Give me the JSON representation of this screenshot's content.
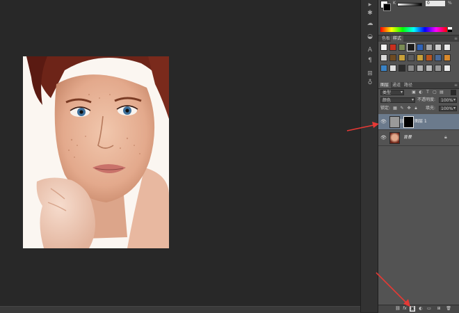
{
  "color_panel": {
    "channel_label": "K",
    "channel_value": "0",
    "channel_unit": "%"
  },
  "swatches_tabs": [
    {
      "label": "色板",
      "active": false
    },
    {
      "label": "样式",
      "active": true
    }
  ],
  "styles_grid": {
    "colors": [
      "#f4f4f4",
      "#c92f1e",
      "#7a8b55",
      "#1b1b1b",
      "#2f63b8",
      "#a8a8a8",
      "#cfcfcf",
      "#e9e9e9",
      "#d9d9d9",
      "#6f4b22",
      "#c8a13a",
      "#5d5d5d",
      "#c8a13a",
      "#b9551f",
      "#4a6a9a",
      "#d98a2c",
      "#3a82c4",
      "#e0e0e0",
      "#2b2b2b",
      "#8a8a8a",
      "#b0b0b0",
      "#bcbcbc",
      "#9a9a9a",
      "#ececec"
    ],
    "selected_index": 3
  },
  "layers_panel": {
    "tabs": [
      {
        "label": "图层",
        "active": true
      },
      {
        "label": "通道",
        "active": false
      },
      {
        "label": "路径",
        "active": false
      }
    ],
    "filter_kind": "类型",
    "blend_mode": "颜色",
    "opacity_label": "不透明度:",
    "opacity_value": "100%",
    "lock_label": "锁定:",
    "fill_label": "填充:",
    "fill_value": "100%",
    "layers": [
      {
        "name": "图层 1",
        "visible": true,
        "selected": true,
        "has_mask": true
      },
      {
        "name": "背景",
        "visible": true,
        "selected": false,
        "locked": true
      }
    ]
  },
  "icons": {
    "strip": [
      "history-icon",
      "actions-icon",
      "properties-icon",
      "adjustments-icon",
      "character-icon",
      "paragraph-icon",
      "brush-preset-icon",
      "clone-source-icon"
    ],
    "layers_bottom": [
      "link-layers-icon",
      "fx-icon",
      "add-mask-icon",
      "adjustment-layer-icon",
      "group-icon",
      "new-layer-icon",
      "trash-icon"
    ]
  },
  "annotation_color": "#e53935"
}
